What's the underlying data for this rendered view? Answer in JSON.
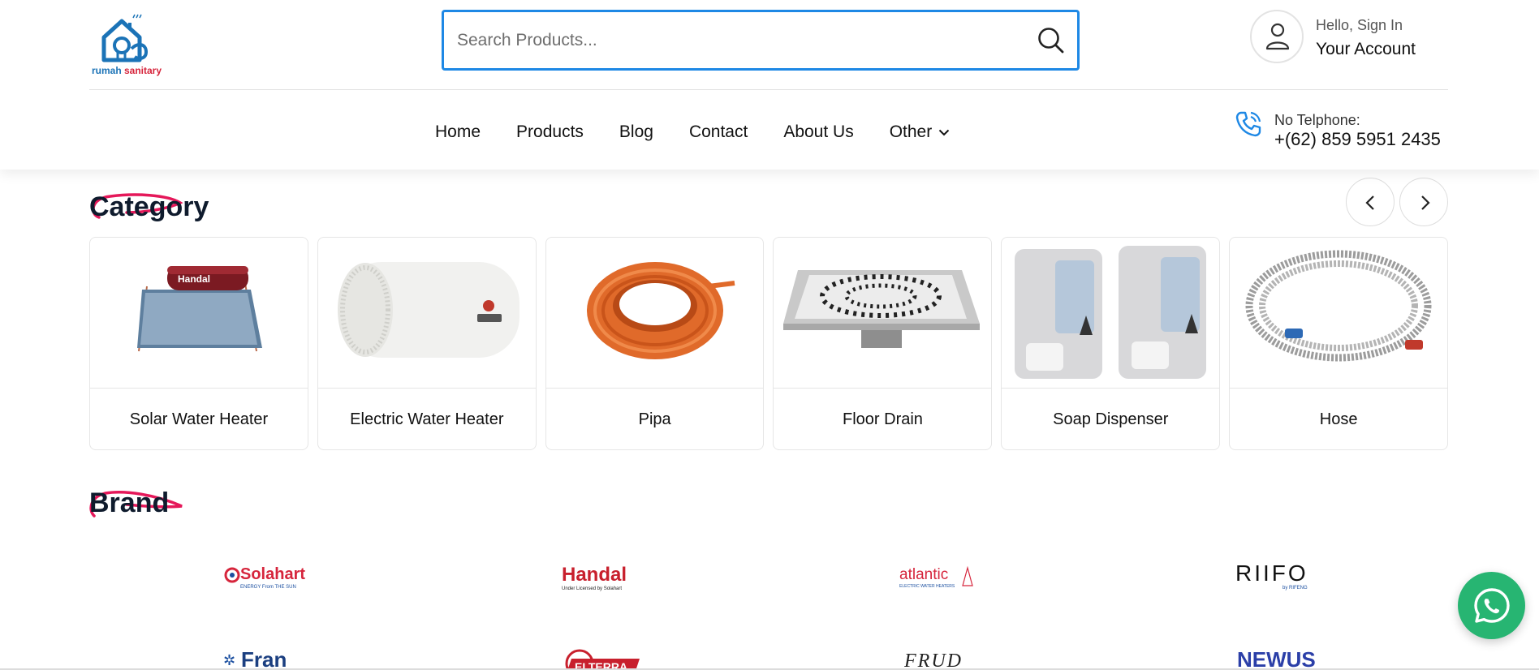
{
  "header": {
    "logo": {
      "name": "rumah sanitary logo",
      "text_blue": "rumah",
      "text_red": "sanitary"
    },
    "search": {
      "placeholder": "Search Products...",
      "icon": "search-icon"
    },
    "account": {
      "greeting": "Hello, Sign In",
      "title": "Your Account",
      "icon": "user-icon"
    },
    "nav": [
      {
        "label": "Home"
      },
      {
        "label": "Products"
      },
      {
        "label": "Blog"
      },
      {
        "label": "Contact"
      },
      {
        "label": "About Us"
      },
      {
        "label": "Other",
        "icon": "chevron-down-icon"
      }
    ],
    "phone": {
      "label": "No Telphone:",
      "number": "+(62) 859 5951 2435",
      "icon": "phone-icon"
    }
  },
  "category": {
    "title": "Category",
    "prev_icon": "chevron-left-icon",
    "next_icon": "chevron-right-icon",
    "items": [
      {
        "label": "Solar Water Heater",
        "image": "solar-water-heater"
      },
      {
        "label": "Electric Water Heater",
        "image": "electric-water-heater"
      },
      {
        "label": "Pipa",
        "image": "orange-pipe-coil"
      },
      {
        "label": "Floor Drain",
        "image": "floor-drain"
      },
      {
        "label": "Soap Dispenser",
        "image": "soap-dispenser"
      },
      {
        "label": "Hose",
        "image": "steel-hose"
      }
    ]
  },
  "brand": {
    "title": "Brand",
    "logos_row1": [
      {
        "name": "Solahart",
        "tagline": "ENERGY From THE SUN"
      },
      {
        "name": "Handal",
        "tagline": "Under Licensed by Solahart"
      },
      {
        "name": "atlantic",
        "tagline": "ELECTRIC WATER HEATERS"
      },
      {
        "name": "RIIFO",
        "tagline": "by RIFENG"
      }
    ],
    "logos_row2": [
      {
        "name": "Fran"
      },
      {
        "name": "ELTERRA"
      },
      {
        "name": "FRUD"
      },
      {
        "name": "NEWUS"
      }
    ]
  },
  "whatsapp": {
    "icon": "whatsapp-icon"
  },
  "colors": {
    "accent": "#1e88e5",
    "stroke": "#e5185a",
    "whatsapp": "#27b572"
  }
}
